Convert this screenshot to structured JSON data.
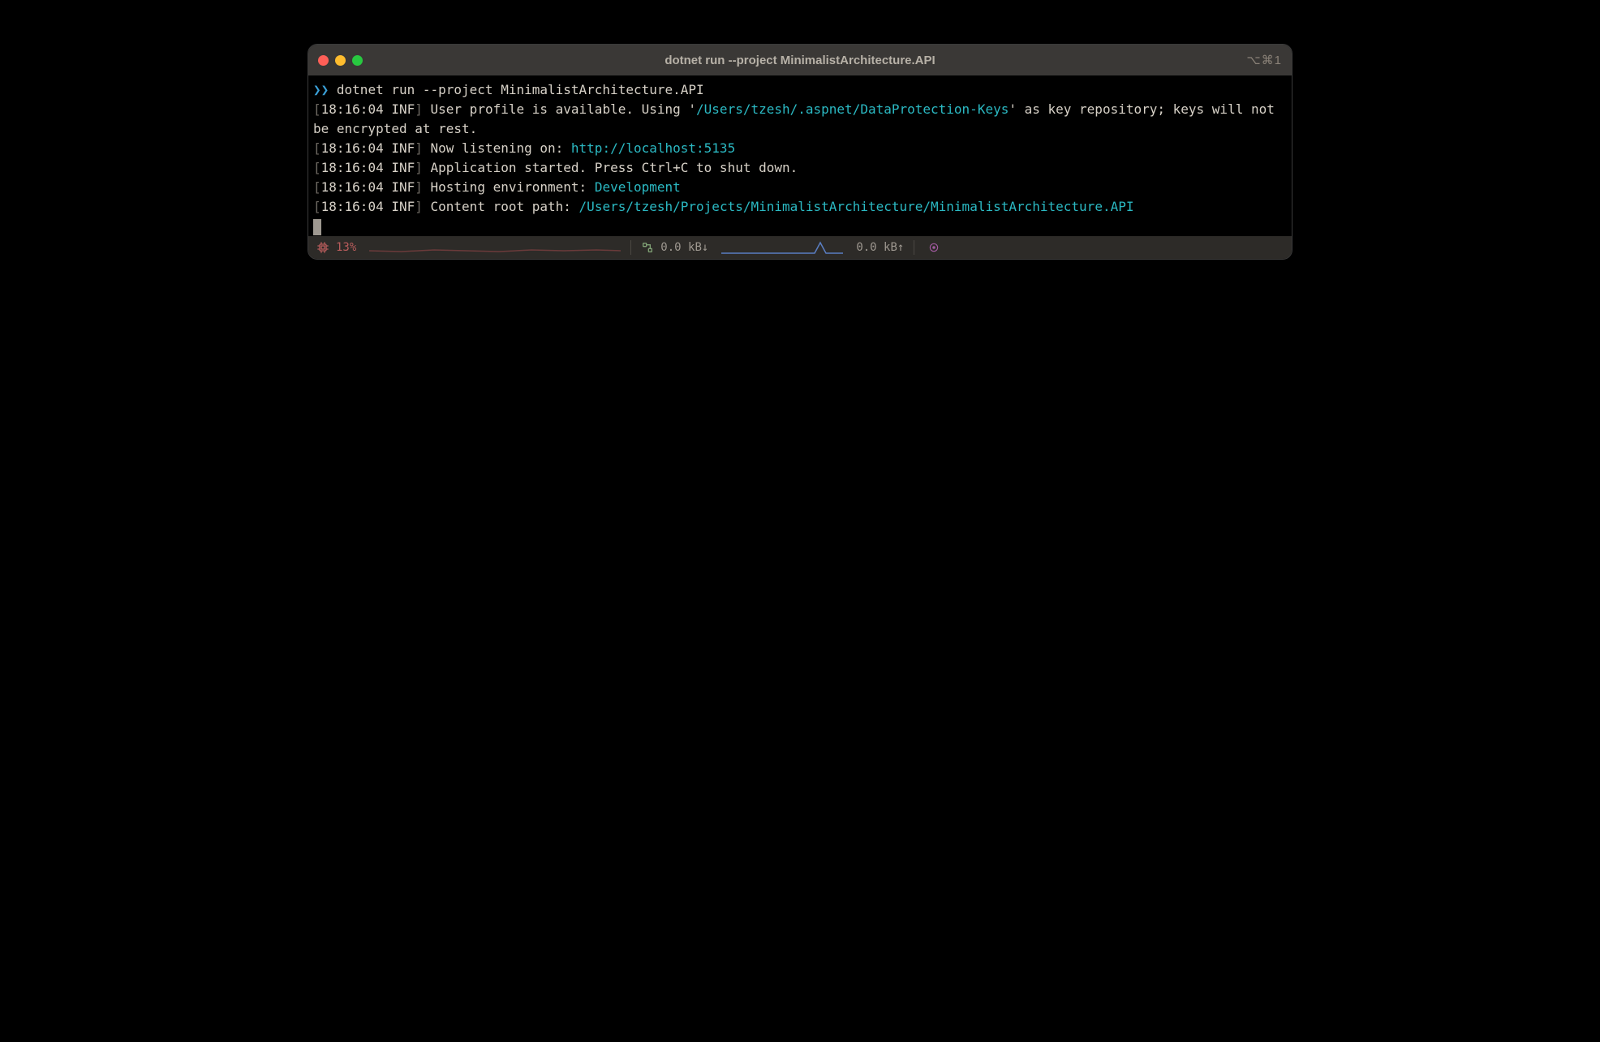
{
  "window": {
    "title": "dotnet run --project MinimalistArchitecture.API",
    "shortcut": "⌥⌘1"
  },
  "prompt": {
    "chevrons": "❯❯",
    "command": "dotnet run --project MinimalistArchitecture.API"
  },
  "logs": [
    {
      "time": "18:16:04",
      "level": "INF",
      "segments": [
        {
          "text": "User profile is available. Using '",
          "cls": "msg"
        },
        {
          "text": "/Users/tzesh/.aspnet/DataProtection-Keys",
          "cls": "path-cyan"
        },
        {
          "text": "' as key repository; keys will not be encrypted at rest.",
          "cls": "msg"
        }
      ]
    },
    {
      "time": "18:16:04",
      "level": "INF",
      "segments": [
        {
          "text": "Now listening on: ",
          "cls": "msg"
        },
        {
          "text": "http://localhost:5135",
          "cls": "url-cyan"
        }
      ]
    },
    {
      "time": "18:16:04",
      "level": "INF",
      "segments": [
        {
          "text": "Application started. Press Ctrl+C to shut down.",
          "cls": "msg"
        }
      ]
    },
    {
      "time": "18:16:04",
      "level": "INF",
      "segments": [
        {
          "text": "Hosting environment: ",
          "cls": "msg"
        },
        {
          "text": "Development",
          "cls": "env-cyan"
        }
      ]
    },
    {
      "time": "18:16:04",
      "level": "INF",
      "segments": [
        {
          "text": "Content root path: ",
          "cls": "msg"
        },
        {
          "text": "/Users/tzesh/Projects/MinimalistArchitecture/MinimalistArchitecture.API",
          "cls": "path-cyan"
        }
      ]
    }
  ],
  "statusbar": {
    "cpu": "13%",
    "net_down": "0.0 kB↓",
    "net_up": "0.0 kB↑"
  },
  "colors": {
    "cyan": "#2bb9c3",
    "promptBlue": "#3aa0d8",
    "cpuRed": "#b85c5c",
    "netBlue": "#5a7ec2",
    "text": "#d7d1c7",
    "dim": "#6f6a63",
    "target": "#a25aa0"
  }
}
